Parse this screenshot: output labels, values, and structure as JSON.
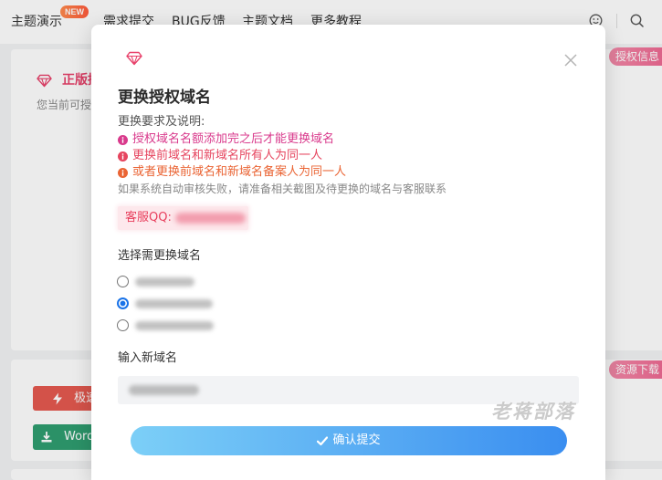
{
  "nav": {
    "items": [
      {
        "label": "主题演示",
        "badge": "NEW"
      },
      {
        "label": "需求提交"
      },
      {
        "label": "BUG反馈"
      },
      {
        "label": "主题文档"
      },
      {
        "label": "更多教程",
        "icon": "chevron-down-icon"
      }
    ],
    "right_icons": [
      "smile-icon",
      "search-icon"
    ]
  },
  "background": {
    "license_card": {
      "icon": "diamond-icon",
      "title": "正版授",
      "description": "您当前可授",
      "tag": "授权信息"
    },
    "download_card": {
      "tag": "资源下载",
      "buttons": [
        {
          "label": "极速",
          "icon": "lightning-icon",
          "color": "#e55a50"
        },
        {
          "label": "Word",
          "icon": "download-icon",
          "color": "#2f9e70"
        }
      ]
    }
  },
  "modal": {
    "icon": "diamond-icon",
    "close_icon": "close-icon",
    "title": "更换授权域名",
    "requirements_heading": "更换要求及说明:",
    "requirements": [
      {
        "text": "授权域名名额添加完之后才能更换域名",
        "icon": "info-icon",
        "color": "#d93a8c"
      },
      {
        "text": "更换前域名和新域名所有人为同一人",
        "icon": "info-icon",
        "color": "#e6455f"
      },
      {
        "text": "或者更换前域名和新域名备案人为同一人",
        "icon": "info-icon",
        "color": "#ea6434"
      }
    ],
    "note": "如果系统自动审核失败，请准备相关截图及待更换的域名与客服联系",
    "support_qq_label": "客服QQ:",
    "select_label": "选择需更换域名",
    "domain_options": [
      {
        "selected": false
      },
      {
        "selected": true
      },
      {
        "selected": false
      }
    ],
    "new_domain_label": "输入新域名",
    "submit": {
      "label": "确认提交",
      "icon": "check-icon"
    }
  },
  "watermark": "老蒋部落",
  "colors": {
    "brand": "#e8416a",
    "accent": "#3a8ef0",
    "tag": "#ee6a93"
  }
}
